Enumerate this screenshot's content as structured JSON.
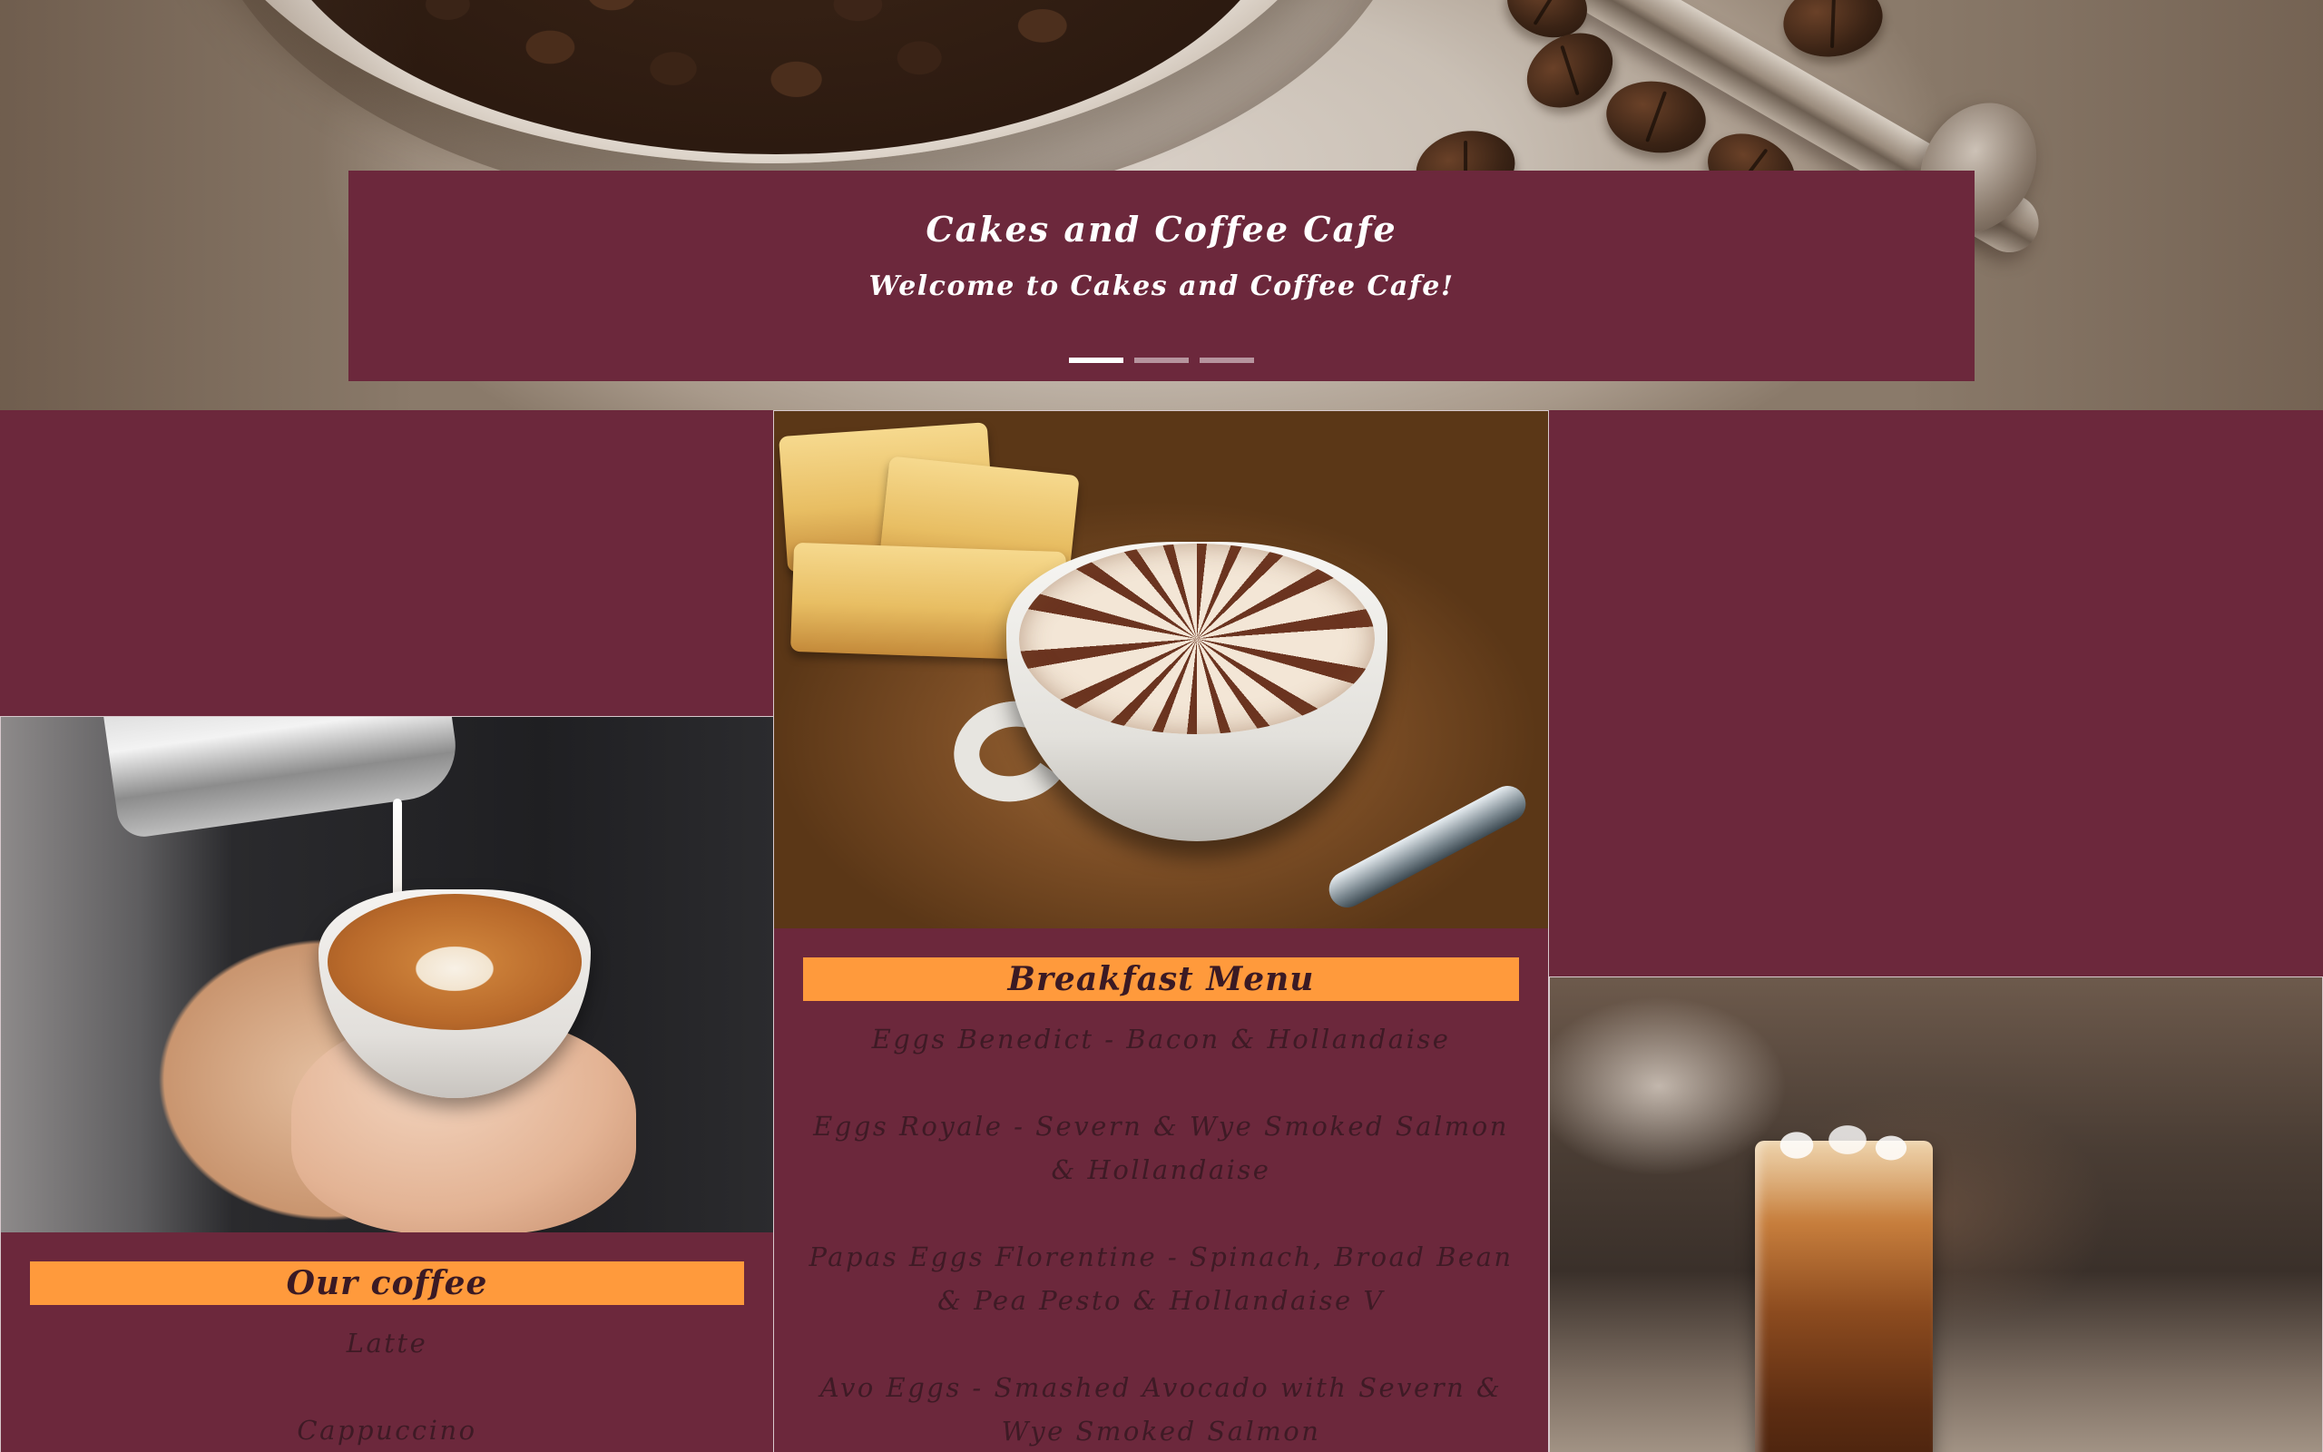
{
  "hero": {
    "title": "Cakes and Coffee Cafe",
    "subtitle": "Welcome to Cakes and Coffee Cafe!",
    "slides": 3,
    "active_slide": 1
  },
  "coffee_card": {
    "heading": "Our coffee",
    "items": [
      "Latte",
      "Cappuccino"
    ]
  },
  "breakfast_card": {
    "heading": "Breakfast Menu",
    "items": [
      "Eggs Benedict - Bacon & Hollandaise",
      "Eggs Royale - Severn & Wye Smoked Salmon & Hollandaise",
      "Papas Eggs Florentine - Spinach, Broad Bean & Pea Pesto & Hollandaise V",
      "Avo Eggs - Smashed Avocado with Severn & Wye Smoked Salmon"
    ]
  },
  "colors": {
    "background": "#6c283c",
    "heading_bar": "#ff9a3c",
    "item_text": "#3e1a25",
    "banner_text": "#ffffff"
  }
}
